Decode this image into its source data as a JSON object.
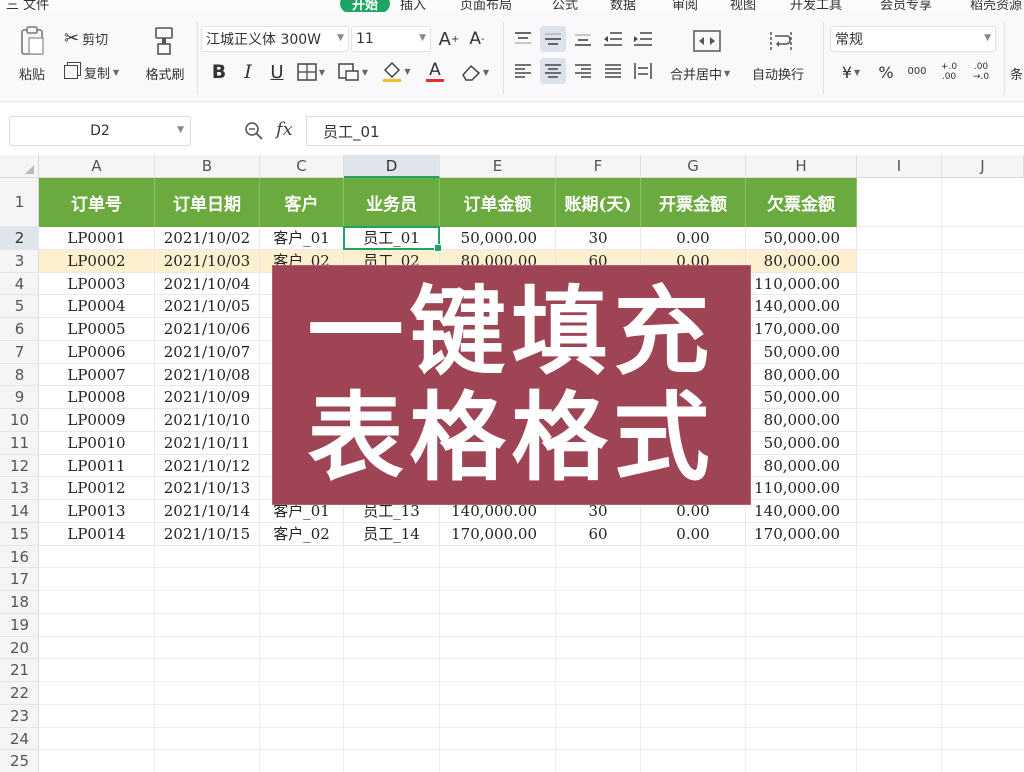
{
  "menubar": {
    "items": [
      "三 文件",
      "开始",
      "插入",
      "页面布局",
      "公式",
      "数据",
      "审阅",
      "视图",
      "开发工具",
      "会员专享",
      "稻壳资源"
    ],
    "active_index": 1
  },
  "ribbon": {
    "paste_label": "粘贴",
    "cut_label": "剪切",
    "copy_label": "复制",
    "format_painter_label": "格式刷",
    "font_name": "江城正义体 300W",
    "font_size": "11",
    "merge_center_label": "合并居中",
    "auto_wrap_label": "自动换行",
    "number_format": "常规",
    "percent_symbol": "%",
    "currency_symbol": "¥",
    "thousands_label": "000",
    "decimal_inc_label": "+.0 .00",
    "decimal_dec_label": ".00 →.0",
    "bold_label": "B",
    "italic_label": "I",
    "underline_label": "U",
    "font_color_label": "A",
    "cut_off_label": "条"
  },
  "formula_bar": {
    "name_box": "D2",
    "fx_label": "fx",
    "formula_value": "员工_01"
  },
  "sheet": {
    "columns": [
      "A",
      "B",
      "C",
      "D",
      "E",
      "F",
      "G",
      "H",
      "I",
      "J"
    ],
    "selected_column": "D",
    "selected_row": 2,
    "row_numbers": [
      "1",
      "2",
      "3",
      "4",
      "5",
      "6",
      "7",
      "8",
      "9",
      "10",
      "11",
      "12",
      "13",
      "14",
      "15",
      "16",
      "17",
      "18",
      "19",
      "20",
      "21",
      "22",
      "23",
      "24",
      "25"
    ],
    "headers": [
      "订单号",
      "订单日期",
      "客户",
      "业务员",
      "订单金额",
      "账期(天)",
      "开票金额",
      "欠票金额"
    ],
    "rows": [
      [
        "LP0001",
        "2021/10/02",
        "客户_01",
        "员工_01",
        "50,000.00",
        "30",
        "0.00",
        "50,000.00"
      ],
      [
        "LP0002",
        "2021/10/03",
        "客户_02",
        "员工_02",
        "80,000.00",
        "60",
        "0.00",
        "80,000.00"
      ],
      [
        "LP0003",
        "2021/10/04",
        "",
        "",
        "",
        "",
        "",
        "110,000.00"
      ],
      [
        "LP0004",
        "2021/10/05",
        "",
        "",
        "",
        "",
        "",
        "140,000.00"
      ],
      [
        "LP0005",
        "2021/10/06",
        "",
        "",
        "",
        "",
        "",
        "170,000.00"
      ],
      [
        "LP0006",
        "2021/10/07",
        "",
        "",
        "",
        "",
        "",
        "50,000.00"
      ],
      [
        "LP0007",
        "2021/10/08",
        "",
        "",
        "",
        "",
        "",
        "80,000.00"
      ],
      [
        "LP0008",
        "2021/10/09",
        "",
        "",
        "",
        "",
        "",
        "50,000.00"
      ],
      [
        "LP0009",
        "2021/10/10",
        "",
        "",
        "",
        "",
        "",
        "80,000.00"
      ],
      [
        "LP0010",
        "2021/10/11",
        "",
        "",
        "",
        "",
        "",
        "50,000.00"
      ],
      [
        "LP0011",
        "2021/10/12",
        "",
        "",
        "",
        "",
        "",
        "80,000.00"
      ],
      [
        "LP0012",
        "2021/10/13",
        "",
        "",
        "",
        "",
        "",
        "110,000.00"
      ],
      [
        "LP0013",
        "2021/10/14",
        "客户_01",
        "员工_13",
        "140,000.00",
        "30",
        "0.00",
        "140,000.00"
      ],
      [
        "LP0014",
        "2021/10/15",
        "客户_02",
        "员工_14",
        "170,000.00",
        "60",
        "0.00",
        "170,000.00"
      ]
    ]
  },
  "banner": {
    "line1": "一键填充",
    "line2": "表格格式",
    "color": "#9f4455"
  },
  "colors": {
    "header_green": "#6aaa3f",
    "accent_green": "#21a366",
    "alt_row_yellow": "#fdf0cf"
  }
}
